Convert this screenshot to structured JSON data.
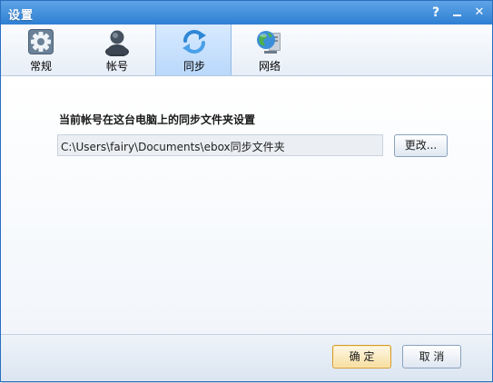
{
  "window": {
    "title": "设置",
    "help_symbol": "?",
    "close_symbol": "✕"
  },
  "tabs": [
    {
      "label": "常规",
      "icon": "gear-icon",
      "active": false
    },
    {
      "label": "帐号",
      "icon": "user-icon",
      "active": false
    },
    {
      "label": "同步",
      "icon": "sync-icon",
      "active": true
    },
    {
      "label": "网络",
      "icon": "network-globe-icon",
      "active": false
    }
  ],
  "sync": {
    "section_title": "当前帐号在这台电脑上的同步文件夹设置",
    "folder_path": "C:\\Users\\fairy\\Documents\\ebox同步文件夹",
    "change_label": "更改..."
  },
  "footer": {
    "ok_label": "确 定",
    "cancel_label": "取 消"
  },
  "colors": {
    "titlebar": "#2e7fd3",
    "active_tab": "#b9d8fb",
    "ok_border": "#d49a2a"
  }
}
